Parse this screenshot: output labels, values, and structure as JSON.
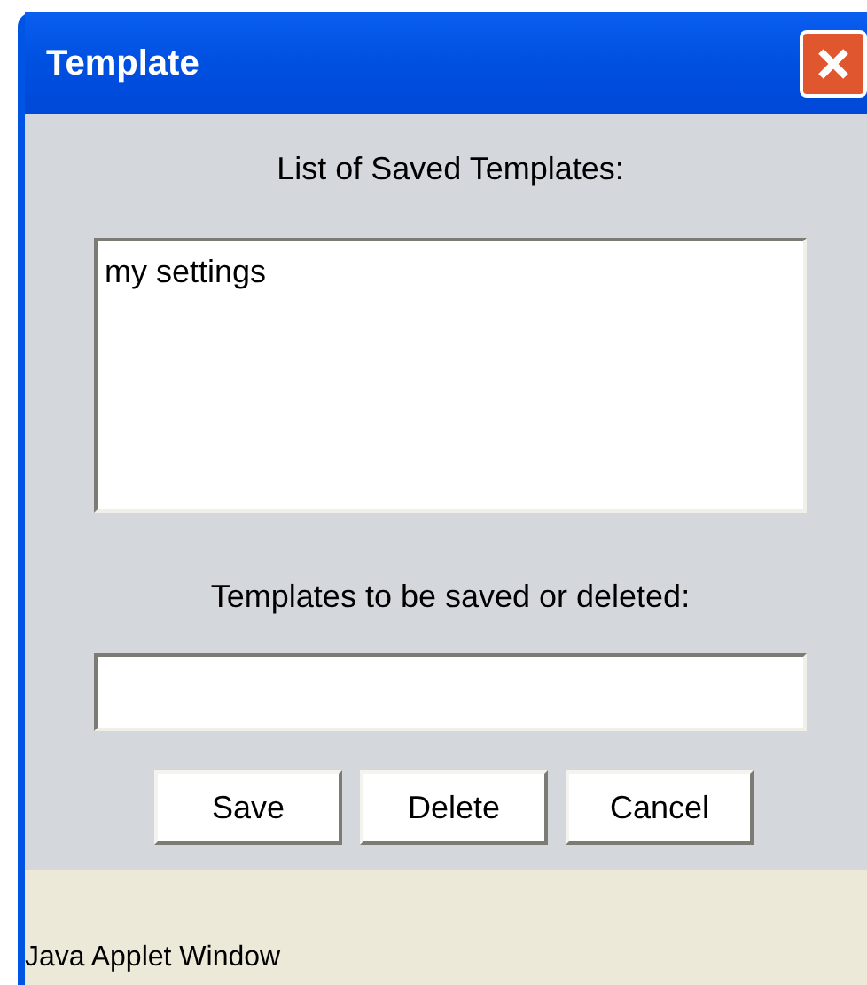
{
  "window": {
    "title": "Template"
  },
  "saved_list": {
    "label": "List of Saved Templates:",
    "items": [
      {
        "text": "my settings",
        "selected": false
      }
    ]
  },
  "name_field": {
    "label": "Templates to be saved or deleted:"
  },
  "buttons": [
    "Save",
    "Delete",
    "Cancel"
  ],
  "status_bar": "Java Applet Window"
}
